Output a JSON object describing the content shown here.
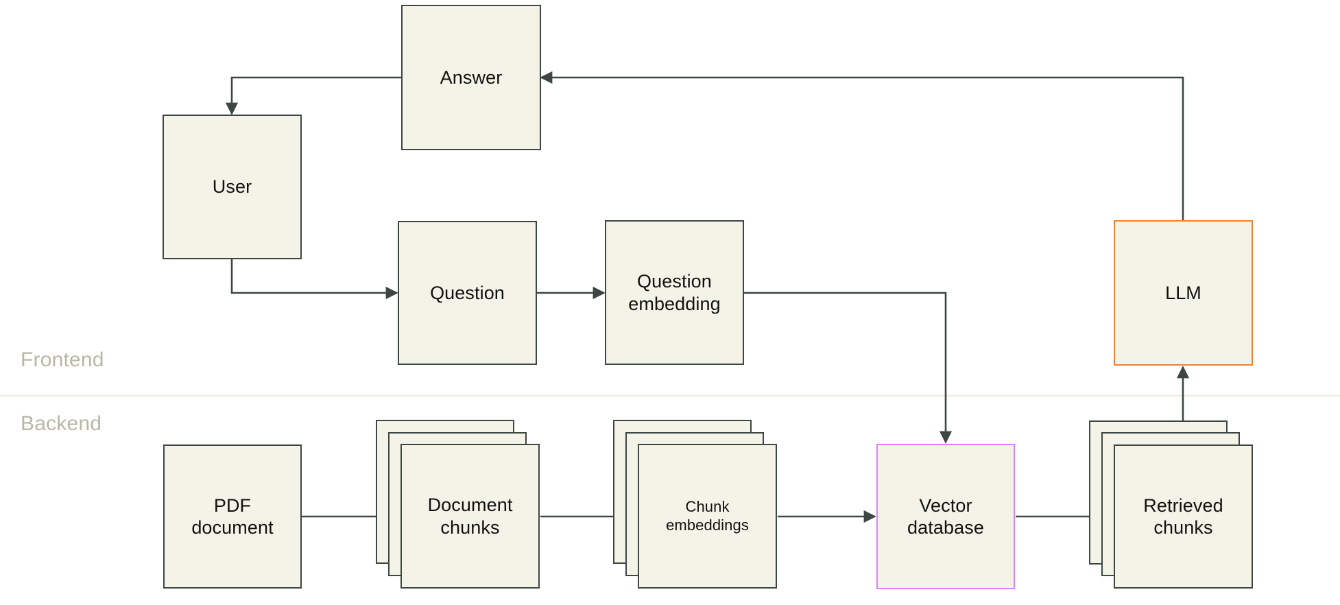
{
  "diagram": {
    "title": "RAG pipeline diagram",
    "colors": {
      "node_fill": "#f4f3e7",
      "node_border": "#3c4742",
      "accent_orange": "#f08133",
      "accent_magenta": "#dd82f5",
      "swimlane_label": "#b9b6a4",
      "divider": "#efeade",
      "edge": "#3c4742",
      "background": "#ffffff"
    },
    "swimlanes": [
      {
        "id": "frontend",
        "label": "Frontend"
      },
      {
        "id": "backend",
        "label": "Backend"
      }
    ],
    "nodes": [
      {
        "id": "answer",
        "label": "Answer",
        "style": "plain",
        "stacked": false
      },
      {
        "id": "user",
        "label": "User",
        "style": "plain",
        "stacked": false
      },
      {
        "id": "question",
        "label": "Question",
        "style": "plain",
        "stacked": false
      },
      {
        "id": "question_embedding",
        "label": "Question\nembedding",
        "style": "plain",
        "stacked": false
      },
      {
        "id": "llm",
        "label": "LLM",
        "style": "orange",
        "stacked": false
      },
      {
        "id": "pdf_document",
        "label": "PDF\ndocument",
        "style": "plain",
        "stacked": false
      },
      {
        "id": "document_chunks",
        "label": "Document\nchunks",
        "style": "plain",
        "stacked": true
      },
      {
        "id": "chunk_embeddings",
        "label": "Chunk\nembeddings",
        "style": "plain",
        "stacked": true
      },
      {
        "id": "vector_database",
        "label": "Vector\ndatabase",
        "style": "magenta",
        "stacked": false
      },
      {
        "id": "retrieved_chunks",
        "label": "Retrieved\nchunks",
        "style": "plain",
        "stacked": true
      }
    ],
    "edges": [
      {
        "from": "llm",
        "to": "answer"
      },
      {
        "from": "answer",
        "to": "user"
      },
      {
        "from": "user",
        "to": "question"
      },
      {
        "from": "question",
        "to": "question_embedding"
      },
      {
        "from": "question_embedding",
        "to": "vector_database"
      },
      {
        "from": "pdf_document",
        "to": "document_chunks"
      },
      {
        "from": "document_chunks",
        "to": "chunk_embeddings"
      },
      {
        "from": "chunk_embeddings",
        "to": "vector_database"
      },
      {
        "from": "vector_database",
        "to": "retrieved_chunks"
      },
      {
        "from": "retrieved_chunks",
        "to": "llm"
      }
    ],
    "labels": {
      "answer": "Answer",
      "user": "User",
      "question": "Question",
      "question_embedding_line1": "Question",
      "question_embedding_line2": "embedding",
      "llm": "LLM",
      "pdf_document_line1": "PDF",
      "pdf_document_line2": "document",
      "document_chunks_line1": "Document",
      "document_chunks_line2": "chunks",
      "chunk_embeddings_line1": "Chunk",
      "chunk_embeddings_line2": "embeddings",
      "vector_database_line1": "Vector",
      "vector_database_line2": "database",
      "retrieved_chunks_line1": "Retrieved",
      "retrieved_chunks_line2": "chunks",
      "frontend": "Frontend",
      "backend": "Backend"
    }
  }
}
